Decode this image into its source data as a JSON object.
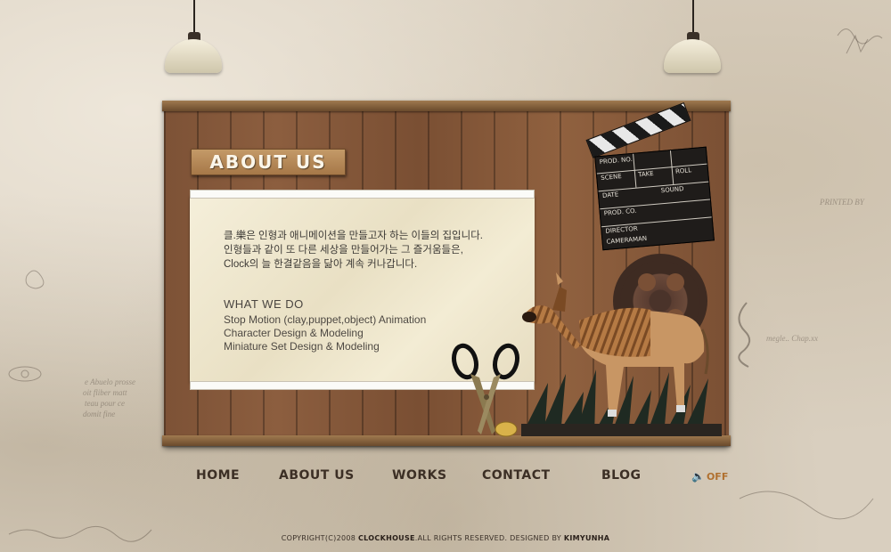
{
  "intro": {
    "line1": "클.樂은 인형과 애니메이션을 만들고자 하는 이들의 집입니다.",
    "line2": "인형들과 같이 또 다른 세상을 만들어가는 그 즐거움들은,",
    "line3": "Clock의 늘 한결같음을 닮아 계속 커나갑니다."
  },
  "section_title": "ABOUT US",
  "what_we_do": {
    "title": "WHAT WE DO",
    "items": [
      "Stop Motion (clay,puppet,object) Animation",
      "Character Design & Modeling",
      "Miniature Set Design & Modeling"
    ]
  },
  "clapper": {
    "prod_no": "PROD. NO.",
    "scene": "SCENE",
    "take": "TAKE",
    "roll": "ROLL",
    "date": "DATE",
    "sound": "SOUND",
    "prod_co": "PROD. CO.",
    "director": "DIRECTOR",
    "cameraman": "CAMERAMAN"
  },
  "nav": {
    "home": "HOME",
    "about": "ABOUT US",
    "works": "WORKS",
    "contact": "CONTACT",
    "blog": "BLOG"
  },
  "sound_toggle": {
    "label": "OFF",
    "icon": "speaker-muted-icon"
  },
  "footer": {
    "prefix": "COPYRIGHT(C)2008 ",
    "brand": "CLOCKHOUSE",
    "middle": ".ALL RIGHTS RESERVED. DESIGNED BY ",
    "designer": "KIMYUNHA"
  },
  "colors": {
    "wood": "#8c5e3f",
    "paper": "#f0e8d0",
    "nav_text": "#3c2f25",
    "accent": "#b0702f"
  }
}
